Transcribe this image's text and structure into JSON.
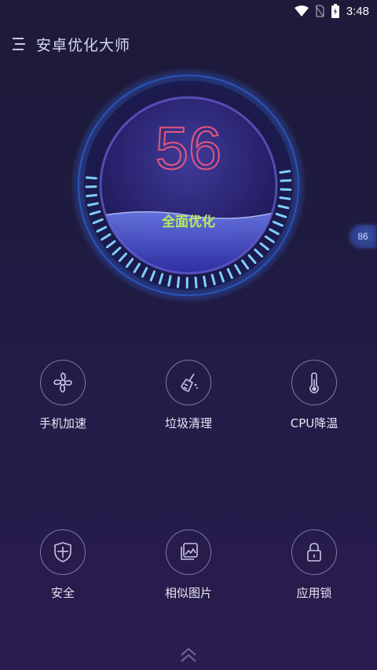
{
  "status_bar": {
    "time": "3:48"
  },
  "header": {
    "title": "安卓优化大师"
  },
  "gauge": {
    "score": "56",
    "action_label": "全面优化",
    "fill_level": 0.56
  },
  "side_badge": {
    "value": "86"
  },
  "features": [
    {
      "label": "手机加速",
      "icon": "fan-icon"
    },
    {
      "label": "垃圾清理",
      "icon": "broom-icon"
    },
    {
      "label": "CPU降温",
      "icon": "thermometer-icon"
    },
    {
      "label": "安全",
      "icon": "shield-icon"
    },
    {
      "label": "相似图片",
      "icon": "gallery-icon"
    },
    {
      "label": "应用锁",
      "icon": "lock-icon"
    }
  ],
  "colors": {
    "score": "#e2587a",
    "action_label": "#b8ec5b",
    "gauge_ticks": "#7fd0ff"
  }
}
